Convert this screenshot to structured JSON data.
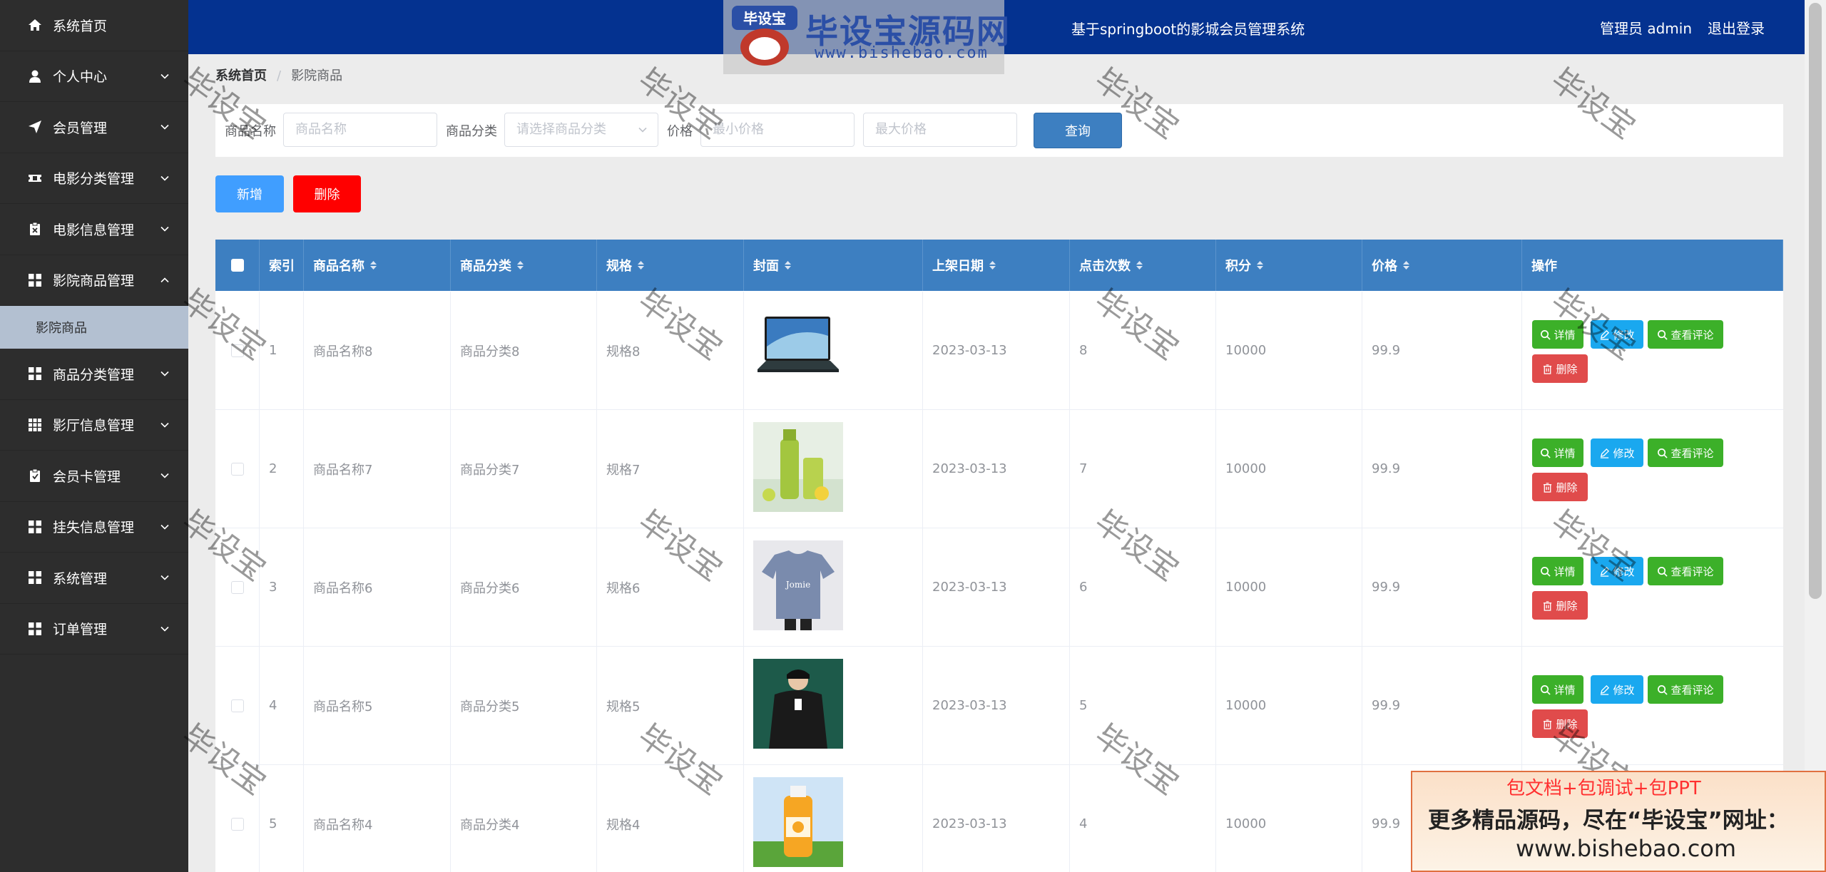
{
  "header": {
    "title": "基于springboot的影城会员管理系统",
    "user_label": "管理员 admin",
    "logout_label": "退出登录"
  },
  "sidebar": {
    "items": [
      {
        "label": "系统首页",
        "icon": "home-icon",
        "has_arrow": false
      },
      {
        "label": "个人中心",
        "icon": "user-icon",
        "has_arrow": true
      },
      {
        "label": "会员管理",
        "icon": "send-icon",
        "has_arrow": true
      },
      {
        "label": "电影分类管理",
        "icon": "ticket-icon",
        "has_arrow": true
      },
      {
        "label": "电影信息管理",
        "icon": "clipboard-icon",
        "has_arrow": true
      },
      {
        "label": "影院商品管理",
        "icon": "grid-icon",
        "has_arrow": true,
        "expanded": true
      },
      {
        "label": "商品分类管理",
        "icon": "grid-icon",
        "has_arrow": true
      },
      {
        "label": "影厅信息管理",
        "icon": "grid9-icon",
        "has_arrow": true
      },
      {
        "label": "会员卡管理",
        "icon": "clipboard-icon",
        "has_arrow": true
      },
      {
        "label": "挂失信息管理",
        "icon": "grid-icon",
        "has_arrow": true
      },
      {
        "label": "系统管理",
        "icon": "grid-icon",
        "has_arrow": true
      },
      {
        "label": "订单管理",
        "icon": "grid-icon",
        "has_arrow": true
      }
    ],
    "active_sub_item": "影院商品"
  },
  "breadcrumb": {
    "home": "系统首页",
    "separator": "/",
    "current": "影院商品"
  },
  "search": {
    "name_label": "商品名称",
    "name_placeholder": "商品名称",
    "category_label": "商品分类",
    "category_placeholder": "请选择商品分类",
    "price_label": "价格",
    "min_price_placeholder": "最小价格",
    "max_price_placeholder": "最大价格",
    "query_button": "查询"
  },
  "actions": {
    "add": "新增",
    "delete": "删除"
  },
  "table": {
    "columns": [
      "索引",
      "商品名称",
      "商品分类",
      "规格",
      "封面",
      "上架日期",
      "点击次数",
      "积分",
      "价格",
      "操作"
    ],
    "rows": [
      {
        "index": "1",
        "name": "商品名称8",
        "category": "商品分类8",
        "spec": "规格8",
        "cover": "laptop",
        "date": "2023-03-13",
        "clicks": "8",
        "points": "10000",
        "price": "99.9"
      },
      {
        "index": "2",
        "name": "商品名称7",
        "category": "商品分类7",
        "spec": "规格7",
        "cover": "green-juice",
        "date": "2023-03-13",
        "clicks": "7",
        "points": "10000",
        "price": "99.9"
      },
      {
        "index": "3",
        "name": "商品名称6",
        "category": "商品分类6",
        "spec": "规格6",
        "cover": "tshirt",
        "date": "2023-03-13",
        "clicks": "6",
        "points": "10000",
        "price": "99.9"
      },
      {
        "index": "4",
        "name": "商品名称5",
        "category": "商品分类5",
        "spec": "规格5",
        "cover": "jacket",
        "date": "2023-03-13",
        "clicks": "5",
        "points": "10000",
        "price": "99.9"
      },
      {
        "index": "5",
        "name": "商品名称4",
        "category": "商品分类4",
        "spec": "规格4",
        "cover": "orange-juice",
        "date": "2023-03-13",
        "clicks": "4",
        "points": "10000",
        "price": "99.9"
      }
    ],
    "row_actions": {
      "detail": "详情",
      "edit": "修改",
      "reviews": "查看评论",
      "delete": "删除"
    }
  },
  "watermark": {
    "text": "毕设宝",
    "logo_title": "毕设宝源码网",
    "logo_badge": "毕设宝",
    "logo_url": "www.bishebao.com"
  },
  "promo": {
    "line1": "包文档+包调试+包PPT",
    "line2": "更多精品源码，尽在“毕设宝”网址：",
    "line3": "www.bishebao.com"
  },
  "colors": {
    "header": "#043290",
    "sidebar": "#2d2d2d",
    "table_header": "#3d7fc1",
    "add_button": "#409eff",
    "delete_button": "#ff0000",
    "detail_button": "#3cb029",
    "edit_button": "#1aa8ef",
    "row_delete_button": "#e04b4b"
  }
}
